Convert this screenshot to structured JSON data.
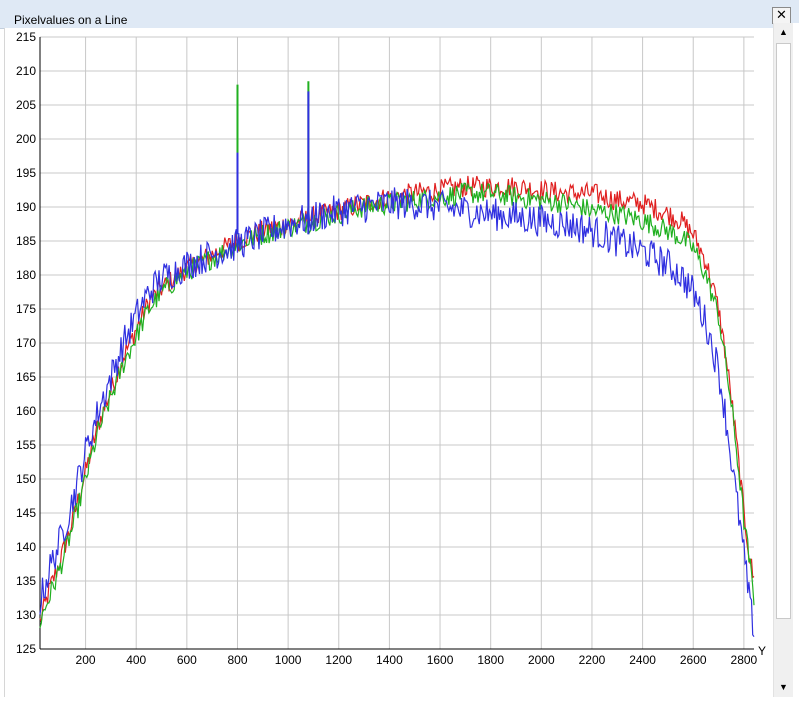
{
  "window": {
    "title": "Pixelvalues on a Line",
    "close_label": "✕",
    "scroll_up_glyph": "▲",
    "scroll_down_glyph": "▼"
  },
  "chart_data": {
    "type": "line",
    "title": "",
    "xlabel": "Y",
    "ylabel": "",
    "xlim": [
      20,
      2840
    ],
    "ylim": [
      125,
      215
    ],
    "x_ticks": [
      200,
      400,
      600,
      800,
      1000,
      1200,
      1400,
      1600,
      1800,
      2000,
      2200,
      2400,
      2600,
      2800
    ],
    "y_ticks": [
      125,
      130,
      135,
      140,
      145,
      150,
      155,
      160,
      165,
      170,
      175,
      180,
      185,
      190,
      195,
      200,
      205,
      210,
      215
    ],
    "grid": true,
    "legend": "none",
    "series": [
      {
        "color": "#e02020",
        "x": [
          20,
          60,
          100,
          150,
          200,
          250,
          300,
          350,
          400,
          450,
          500,
          600,
          700,
          800,
          900,
          1000,
          1100,
          1200,
          1300,
          1400,
          1500,
          1600,
          1700,
          1800,
          1900,
          2000,
          2100,
          2200,
          2300,
          2400,
          2500,
          2550,
          2600,
          2650,
          2700,
          2725,
          2750,
          2775,
          2800,
          2825,
          2840
        ],
        "y": [
          129,
          134,
          138,
          144,
          151,
          158,
          163,
          168,
          172,
          176,
          178,
          181,
          183,
          185,
          186.5,
          187.5,
          188.5,
          189.5,
          190.5,
          191.5,
          192,
          192.5,
          193,
          193,
          193,
          192.5,
          192,
          192,
          191,
          190.5,
          189,
          188,
          186,
          182,
          175,
          169,
          162,
          154,
          145,
          138,
          135
        ]
      },
      {
        "color": "#20b020",
        "x": [
          20,
          60,
          100,
          150,
          200,
          250,
          300,
          350,
          400,
          450,
          500,
          600,
          700,
          800,
          900,
          1000,
          1100,
          1200,
          1300,
          1400,
          1500,
          1600,
          1700,
          1800,
          1900,
          2000,
          2100,
          2200,
          2300,
          2400,
          2500,
          2550,
          2600,
          2650,
          2700,
          2725,
          2750,
          2775,
          2800,
          2825,
          2840
        ],
        "y": [
          129,
          133,
          137,
          143,
          150,
          157,
          162,
          167,
          171,
          175,
          177.5,
          180.5,
          182.5,
          184.5,
          186,
          187,
          188,
          189,
          190,
          190.5,
          191,
          191.5,
          192,
          192,
          191.5,
          191,
          190.5,
          189.5,
          189,
          188,
          186.5,
          185.5,
          184,
          180,
          174,
          168,
          161,
          153,
          144,
          137,
          132
        ]
      },
      {
        "color": "#3030e0",
        "x": [
          20,
          60,
          100,
          150,
          200,
          250,
          300,
          350,
          400,
          450,
          500,
          600,
          700,
          800,
          900,
          1000,
          1100,
          1200,
          1300,
          1400,
          1500,
          1600,
          1700,
          1800,
          1900,
          2000,
          2100,
          2200,
          2300,
          2400,
          2500,
          2550,
          2600,
          2650,
          2700,
          2725,
          2750,
          2775,
          2800,
          2825,
          2840
        ],
        "y": [
          132,
          137,
          141,
          147,
          154,
          160,
          165,
          170,
          174,
          177.5,
          179.5,
          181.5,
          183,
          184.5,
          186,
          187.5,
          188.5,
          189.5,
          190,
          190.5,
          190.5,
          190,
          189.5,
          189,
          188.5,
          188,
          187.5,
          186.5,
          185,
          183.5,
          181.5,
          180,
          177.5,
          173,
          166,
          160,
          153,
          146,
          139,
          131,
          128
        ]
      }
    ],
    "spikes": [
      {
        "x": 800,
        "y": 208,
        "color": "#20b020"
      },
      {
        "x": 800,
        "y": 198,
        "color": "#3030e0"
      },
      {
        "x": 1080,
        "y": 208.5,
        "color": "#20b020"
      },
      {
        "x": 1080,
        "y": 207,
        "color": "#3030e0"
      }
    ]
  }
}
